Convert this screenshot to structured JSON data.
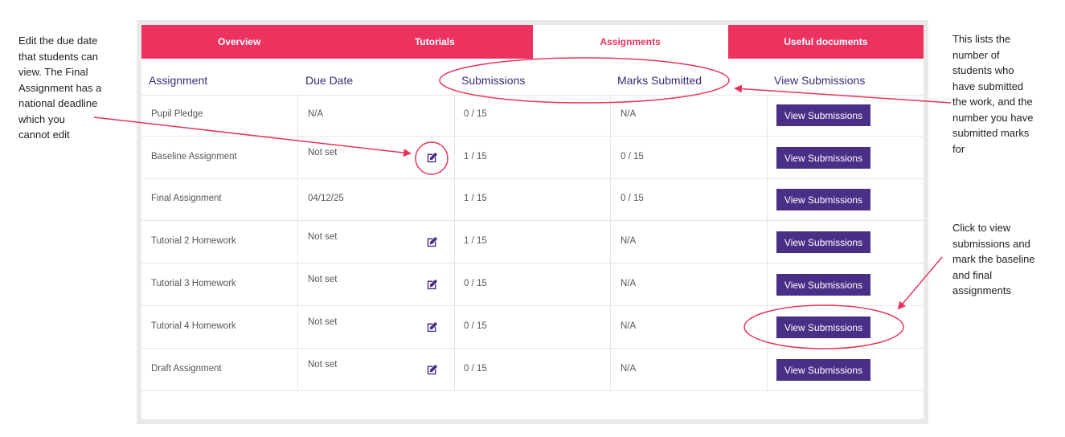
{
  "tabs": [
    {
      "label": "Overview",
      "active": false
    },
    {
      "label": "Tutorials",
      "active": false
    },
    {
      "label": "Assignments",
      "active": true
    },
    {
      "label": "Useful documents",
      "active": false
    }
  ],
  "table": {
    "headers": {
      "assignment": "Assignment",
      "due_date": "Due Date",
      "submissions": "Submissions",
      "marks_submitted": "Marks Submitted",
      "view_submissions": "View Submissions"
    },
    "rows": [
      {
        "assignment": "Pupil Pledge",
        "due_date": "N/A",
        "editable": false,
        "submissions": "0 / 15",
        "marks": "N/A",
        "button": "View Submissions"
      },
      {
        "assignment": "Baseline Assignment",
        "due_date": "Not set",
        "editable": true,
        "submissions": "1 / 15",
        "marks": "0 / 15",
        "button": "View Submissions"
      },
      {
        "assignment": "Final Assignment",
        "due_date": "04/12/25",
        "editable": false,
        "submissions": "1 / 15",
        "marks": "0 / 15",
        "button": "View Submissions"
      },
      {
        "assignment": "Tutorial 2 Homework",
        "due_date": "Not set",
        "editable": true,
        "submissions": "1 / 15",
        "marks": "N/A",
        "button": "View Submissions"
      },
      {
        "assignment": "Tutorial 3 Homework",
        "due_date": "Not set",
        "editable": true,
        "submissions": "0 / 15",
        "marks": "N/A",
        "button": "View Submissions"
      },
      {
        "assignment": "Tutorial 4 Homework",
        "due_date": "Not set",
        "editable": true,
        "submissions": "0 / 15",
        "marks": "N/A",
        "button": "View Submissions"
      },
      {
        "assignment": "Draft Assignment",
        "due_date": "Not set",
        "editable": true,
        "submissions": "0 / 15",
        "marks": "N/A",
        "button": "View Submissions"
      }
    ]
  },
  "annotations": {
    "left": [
      "Edit the due date",
      "that students can",
      "view. The Final",
      "Assignment has a",
      "national deadline",
      "which you",
      "cannot edit"
    ],
    "right_top": [
      "This lists the",
      "number of",
      "students who",
      "have submitted",
      "the work, and the",
      "number you have",
      "submitted marks",
      "for"
    ],
    "right_bottom": [
      "Click to view",
      "submissions and",
      "mark the baseline",
      "and final",
      "assignments"
    ]
  },
  "colors": {
    "tab_pink": "#ec3360",
    "button_purple": "#4a2f86",
    "header_text": "#3d2a78",
    "annotation": "#e8335c"
  },
  "icons": {
    "edit": "edit-pencil-icon"
  }
}
